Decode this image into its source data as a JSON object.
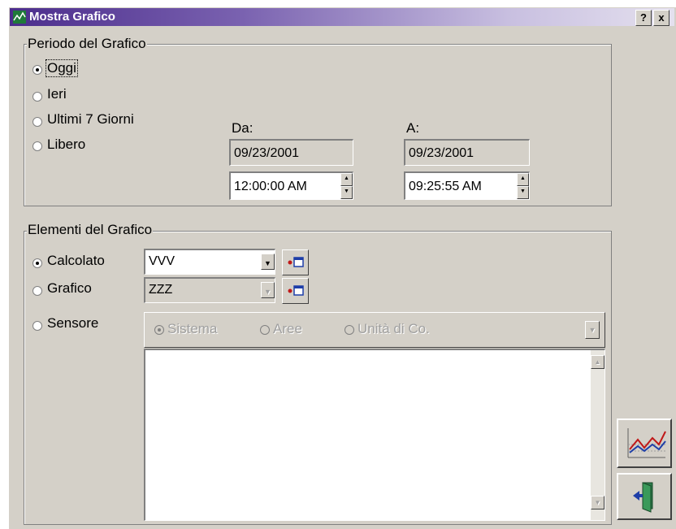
{
  "window": {
    "title": "Mostra Grafico",
    "help_label": "?",
    "close_label": "x"
  },
  "period": {
    "legend": "Periodo del Grafico",
    "options": [
      "Oggi",
      "Ieri",
      "Ultimi 7 Giorni",
      "Libero"
    ],
    "selected": "Oggi",
    "from_label": "Da:",
    "to_label": "A:",
    "from_date": "09/23/2001",
    "from_time": "12:00:00 AM",
    "to_date": "09/23/2001",
    "to_time": "09:25:55 AM"
  },
  "elements": {
    "legend": "Elementi del Grafico",
    "options": [
      "Calcolato",
      "Grafico",
      "Sensore"
    ],
    "selected": "Calcolato",
    "calcolato_value": "VVV",
    "grafico_value": "ZZZ",
    "sensor_options": [
      "Sistema",
      "Aree",
      "Unità di Co."
    ],
    "sensor_selected": "Sistema"
  },
  "colors": {
    "face": "#d4d0c8",
    "title_start": "#4b2d8c",
    "title_end": "#e4e0ee"
  }
}
